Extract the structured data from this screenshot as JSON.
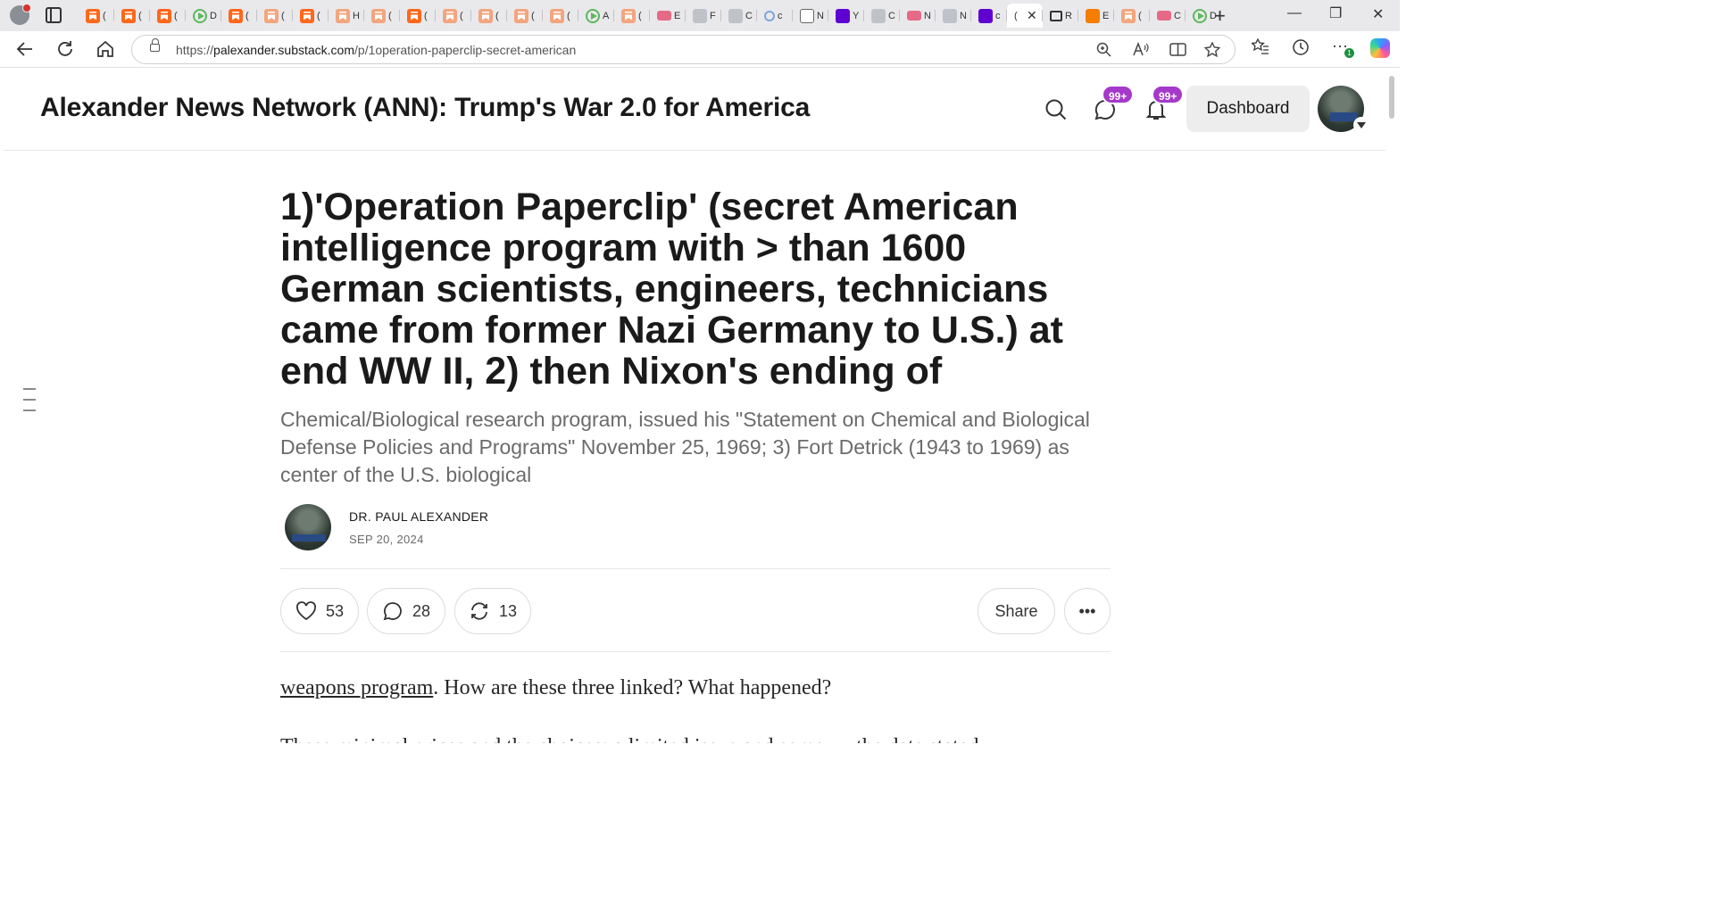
{
  "browser": {
    "tabs": [
      {
        "icon": "substack-icon",
        "letter": "("
      },
      {
        "icon": "substack-icon",
        "letter": "("
      },
      {
        "icon": "substack-icon",
        "letter": "("
      },
      {
        "icon": "play-icon",
        "letter": "D"
      },
      {
        "icon": "substack-icon",
        "letter": "("
      },
      {
        "icon": "substack-faded-icon",
        "letter": "("
      },
      {
        "icon": "substack-icon",
        "letter": "("
      },
      {
        "icon": "substack-faded-icon",
        "letter": "H"
      },
      {
        "icon": "substack-faded-icon",
        "letter": "("
      },
      {
        "icon": "substack-icon",
        "letter": "("
      },
      {
        "icon": "substack-faded-icon",
        "letter": "("
      },
      {
        "icon": "substack-faded-icon",
        "letter": "("
      },
      {
        "icon": "substack-faded-icon",
        "letter": "("
      },
      {
        "icon": "substack-faded-icon",
        "letter": "("
      },
      {
        "icon": "play-icon",
        "letter": "A"
      },
      {
        "icon": "substack-faded-icon",
        "letter": "("
      },
      {
        "icon": "youtube-icon",
        "letter": "E"
      },
      {
        "icon": "news-icon",
        "letter": "F"
      },
      {
        "icon": "image-icon",
        "letter": "C"
      },
      {
        "icon": "search-icon",
        "letter": "c"
      },
      {
        "icon": "document-icon",
        "letter": "N"
      },
      {
        "icon": "yahoo-icon",
        "letter": "Y"
      },
      {
        "icon": "bird-icon",
        "letter": "C"
      },
      {
        "icon": "youtube-icon",
        "letter": "N"
      },
      {
        "icon": "robot-icon",
        "letter": "N"
      },
      {
        "icon": "yahoo-icon",
        "letter": "c"
      },
      {
        "icon": "active-tab",
        "letter": "("
      },
      {
        "icon": "speaker-icon",
        "letter": "R"
      },
      {
        "icon": "blogger-icon",
        "letter": "E"
      },
      {
        "icon": "substack-faded-icon",
        "letter": "("
      },
      {
        "icon": "youtube-icon",
        "letter": "C"
      },
      {
        "icon": "play-icon",
        "letter": "D"
      }
    ],
    "url_prefix": "https://",
    "url_host": "palexander.substack.com",
    "url_path": "/p/1operation-paperclip-secret-american",
    "extension_badge": "1"
  },
  "site": {
    "title": "Alexander News Network (ANN): Trump's War 2.0 for America",
    "messages_badge": "99+",
    "notifications_badge": "99+",
    "dashboard_label": "Dashboard"
  },
  "post": {
    "title": "1)'Operation Paperclip' (secret American intelligence program with > than 1600 German scientists, engineers, technicians came from former Nazi Germany to U.S.) at end WW II, 2) then Nixon's ending of",
    "subtitle": "Chemical/Biological research program, issued his \"Statement on Chemical and Biological Defense Policies and Programs\" November 25, 1969; 3) Fort Detrick (1943 to 1969) as center of the U.S. biological",
    "author": "DR. PAUL ALEXANDER",
    "date": "SEP 20, 2024",
    "likes": "53",
    "comments": "28",
    "restacks": "13",
    "share_label": "Share",
    "more_label": "•••",
    "body_link": "weapons program",
    "body_rest": ". How are these three linked? What happened?",
    "body_cut": "These minimal prices and the choices; a limited issue and some … the date stated…"
  }
}
